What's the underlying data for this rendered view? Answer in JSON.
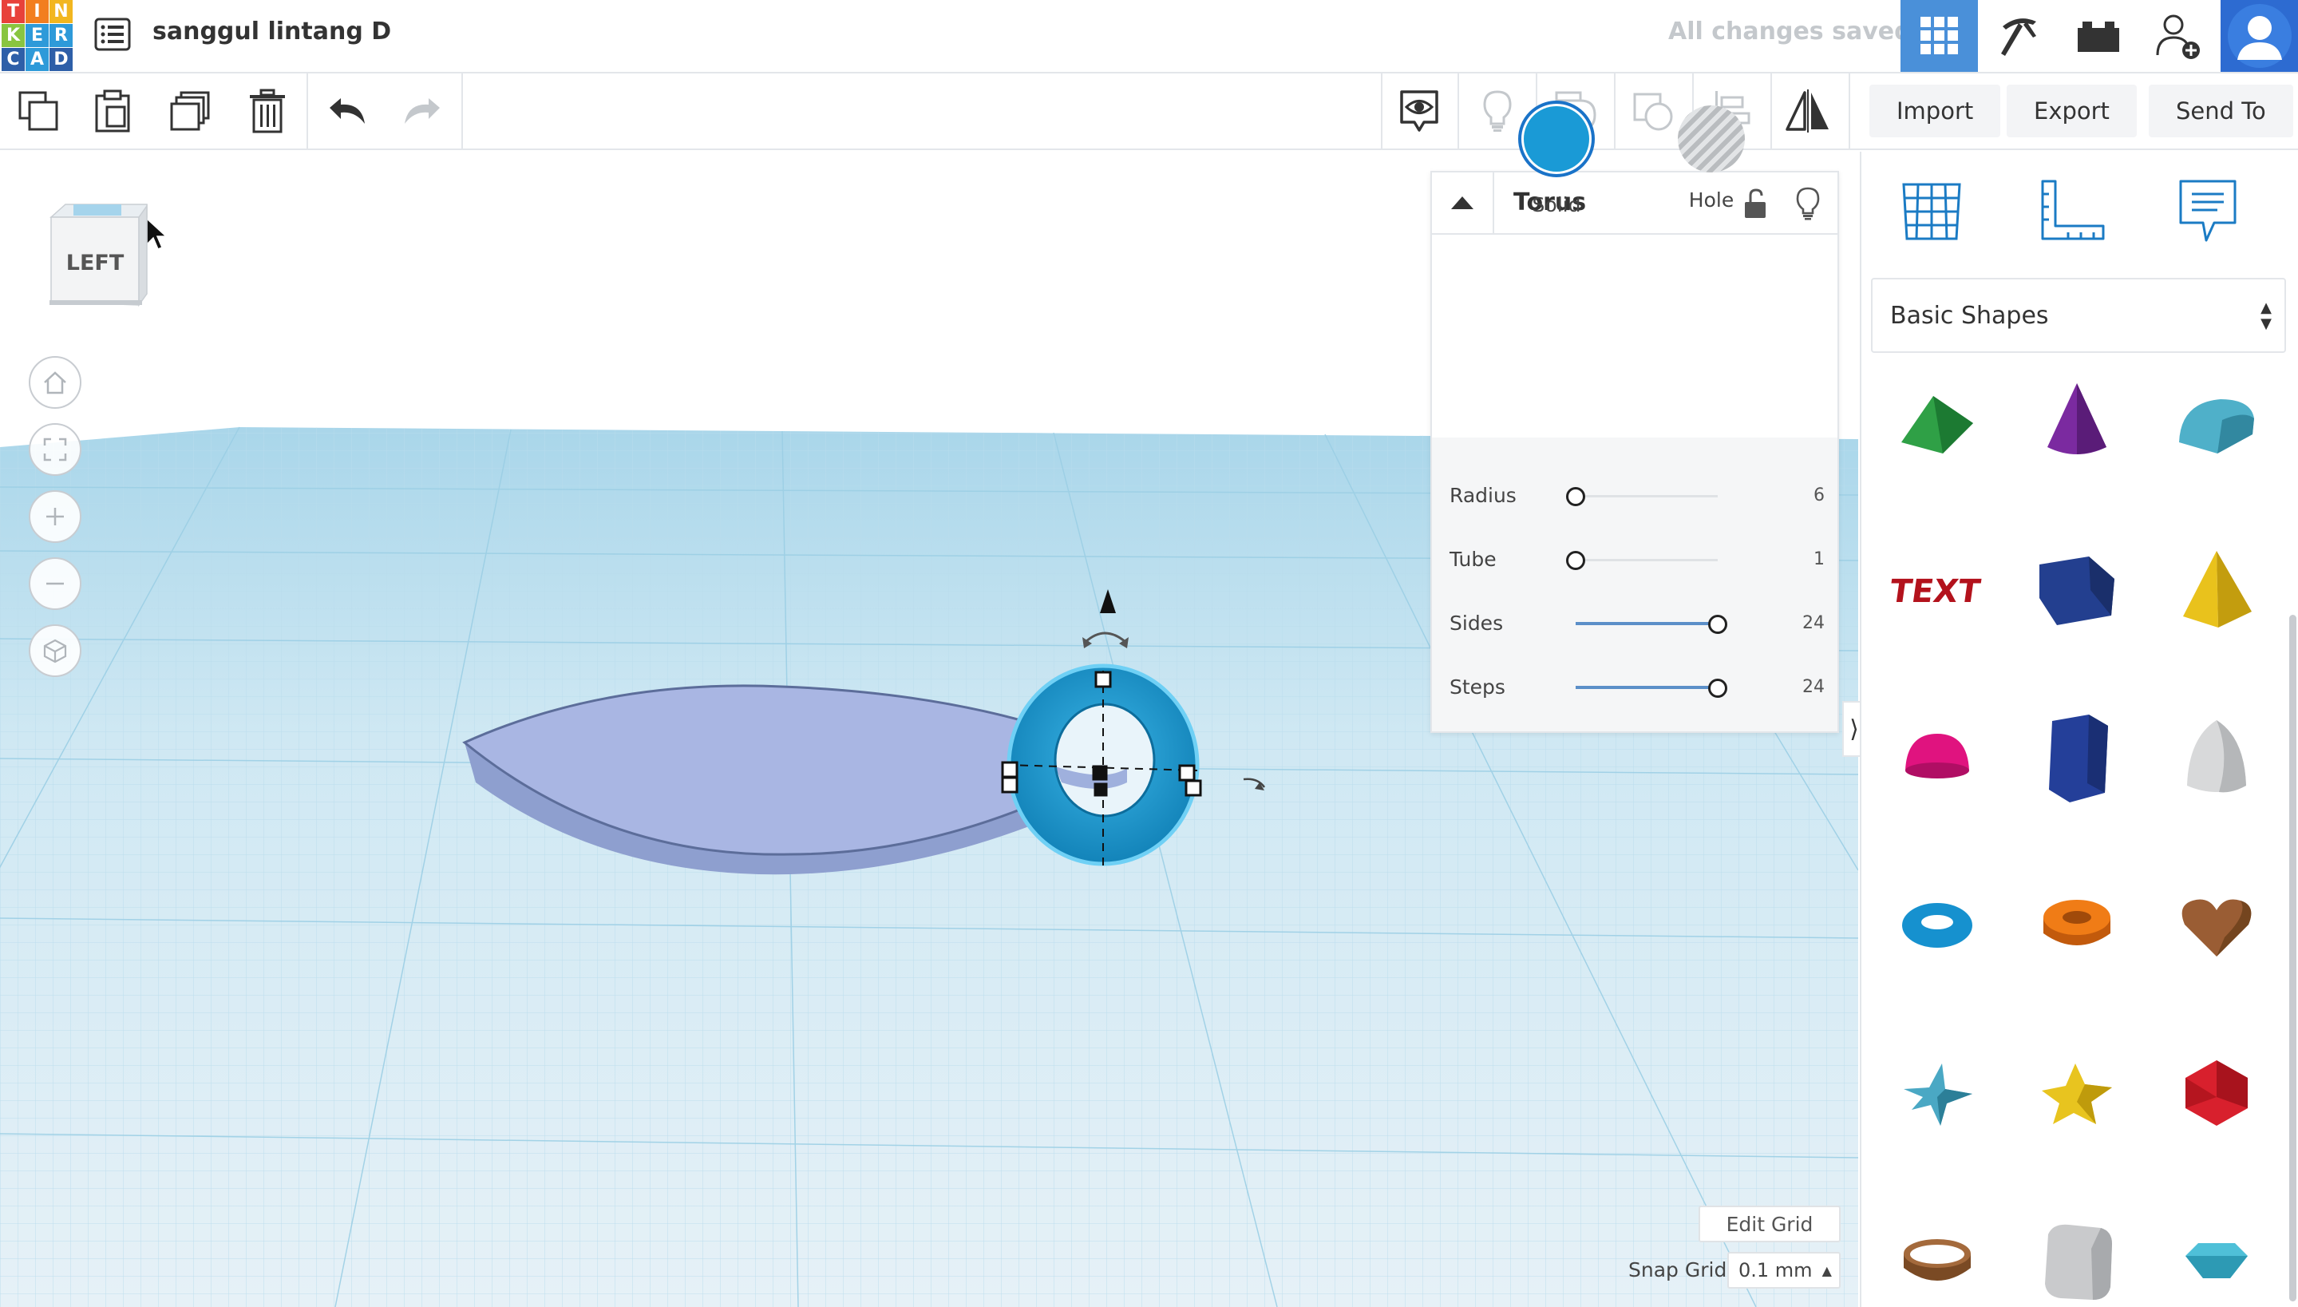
{
  "header": {
    "logo_letters": [
      "T",
      "I",
      "N",
      "K",
      "E",
      "R",
      "C",
      "A",
      "D"
    ],
    "logo_colors": [
      "#e8413a",
      "#f27e1f",
      "#f2b61f",
      "#89c540",
      "#2e9ad9",
      "#2e9ad9",
      "#2e5fa8",
      "#2e9ad9",
      "#2e5fa8"
    ],
    "design_title": "sanggul lintang D",
    "save_status": "All changes saved"
  },
  "toolbar": {
    "import_label": "Import",
    "export_label": "Export",
    "send_to_label": "Send To"
  },
  "viewport": {
    "view_cube_label": "LEFT",
    "edit_grid_label": "Edit Grid",
    "snap_grid_label": "Snap Grid",
    "snap_grid_value": "0.1 mm"
  },
  "inspector": {
    "title": "Torus",
    "solid_label": "Solid",
    "hole_label": "Hole",
    "solid_color": "#1a9ad6",
    "params": [
      {
        "name": "Radius",
        "value": "6",
        "fraction": 0.0
      },
      {
        "name": "Tube",
        "value": "1",
        "fraction": 0.0
      },
      {
        "name": "Sides",
        "value": "24",
        "fraction": 1.0
      },
      {
        "name": "Steps",
        "value": "24",
        "fraction": 1.0
      }
    ]
  },
  "sidebar": {
    "category": "Basic Shapes",
    "shapes": [
      "roof-shape-icon",
      "cone-shape-icon",
      "half-cylinder-shape-icon",
      "text-shape-icon",
      "box-shape-icon",
      "pyramid-shape-icon",
      "hemisphere-shape-icon",
      "polygon-shape-icon",
      "paraboloid-shape-icon",
      "torus-shape-icon",
      "tube-shape-icon",
      "heart-shape-icon",
      "star-teal-shape-icon",
      "star-yellow-shape-icon",
      "icosahedron-shape-icon",
      "ring-shape-icon",
      "rounded-box-shape-icon",
      "diamond-shape-icon"
    ]
  }
}
